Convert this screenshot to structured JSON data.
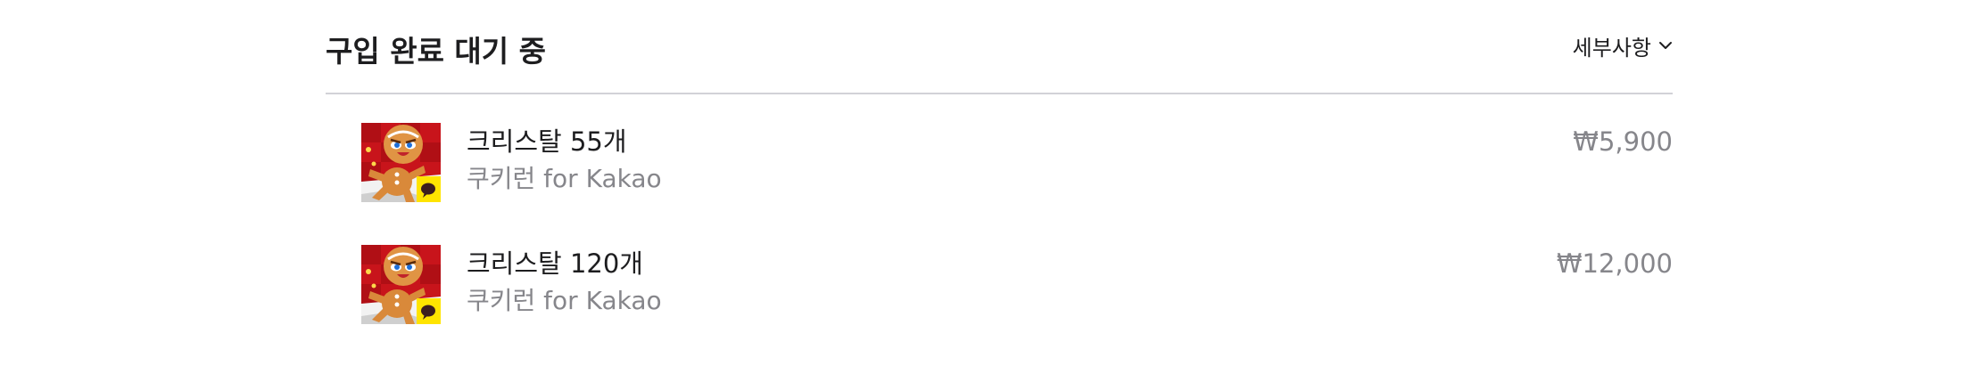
{
  "header": {
    "title": "구입 완료 대기 중",
    "details_label": "세부사항"
  },
  "items": [
    {
      "name": "크리스탈 55개",
      "app": "쿠키런 for Kakao",
      "price": "₩5,900",
      "icon": "cookie-run-app-icon"
    },
    {
      "name": "크리스탈 120개",
      "app": "쿠키런 for Kakao",
      "price": "₩12,000",
      "icon": "cookie-run-app-icon"
    }
  ],
  "colors": {
    "text_primary": "#1d1d1f",
    "text_secondary": "#86868b",
    "divider": "#d2d2d7",
    "icon_red": "#c8141b",
    "icon_yellow": "#ffe400",
    "cookie_brown": "#d9893a"
  }
}
